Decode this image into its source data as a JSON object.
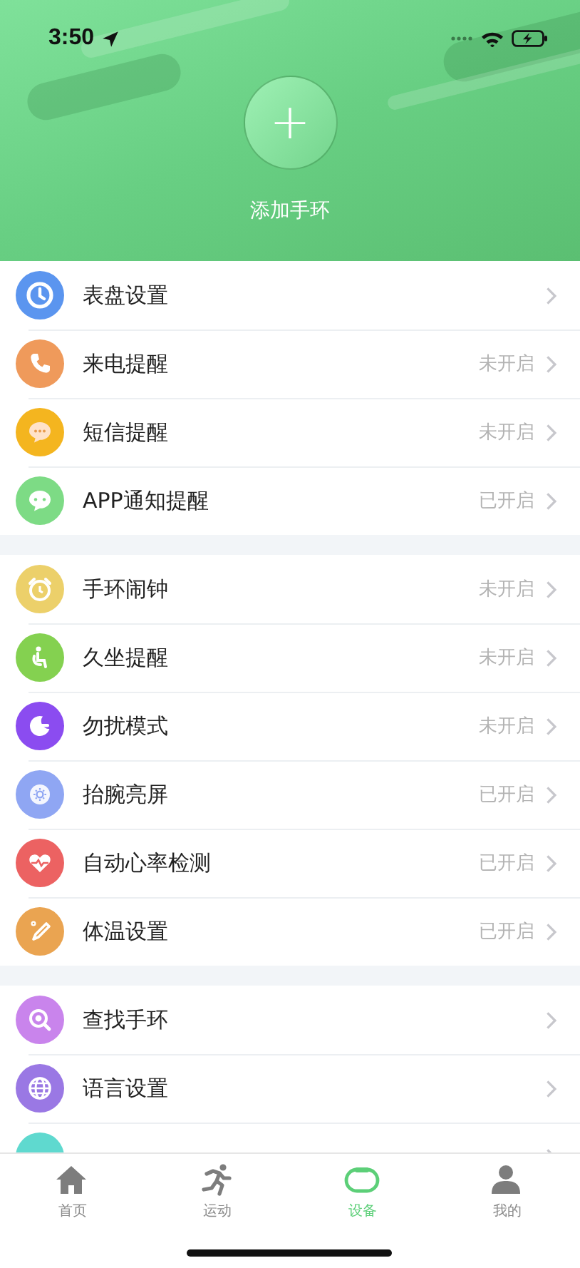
{
  "status_bar": {
    "time": "3:50"
  },
  "header": {
    "add_button": "+",
    "label": "添加手环"
  },
  "groups": [
    {
      "items": [
        {
          "label": "表盘设置",
          "color": "#5b95ef"
        },
        {
          "label": "来电提醒",
          "status": "未开启",
          "color": "#ef9a5b"
        },
        {
          "label": "短信提醒",
          "status": "未开启",
          "color": "#f4b51f"
        },
        {
          "label": "APP通知提醒",
          "status": "已开启",
          "color": "#7ddb85"
        }
      ]
    },
    {
      "items": [
        {
          "label": "手环闹钟",
          "status": "未开启",
          "color": "#ecd06a"
        },
        {
          "label": "久坐提醒",
          "status": "未开启",
          "color": "#84d150"
        },
        {
          "label": "勿扰模式",
          "status": "未开启",
          "color": "#8b4cf0"
        },
        {
          "label": "抬腕亮屏",
          "status": "已开启",
          "color": "#8fa6f3"
        },
        {
          "label": "自动心率检测",
          "status": "已开启",
          "color": "#ec6262"
        },
        {
          "label": "体温设置",
          "status": "已开启",
          "color": "#eaa451"
        }
      ]
    },
    {
      "items": [
        {
          "label": "查找手环",
          "color": "#c984ec"
        },
        {
          "label": "语言设置",
          "color": "#9a78e4"
        },
        {
          "color": "#5fd9cf"
        }
      ]
    }
  ],
  "tabs": [
    {
      "label": "首页",
      "selected": false
    },
    {
      "label": "运动",
      "selected": false
    },
    {
      "label": "设备",
      "selected": true
    },
    {
      "label": "我的",
      "selected": false
    }
  ]
}
